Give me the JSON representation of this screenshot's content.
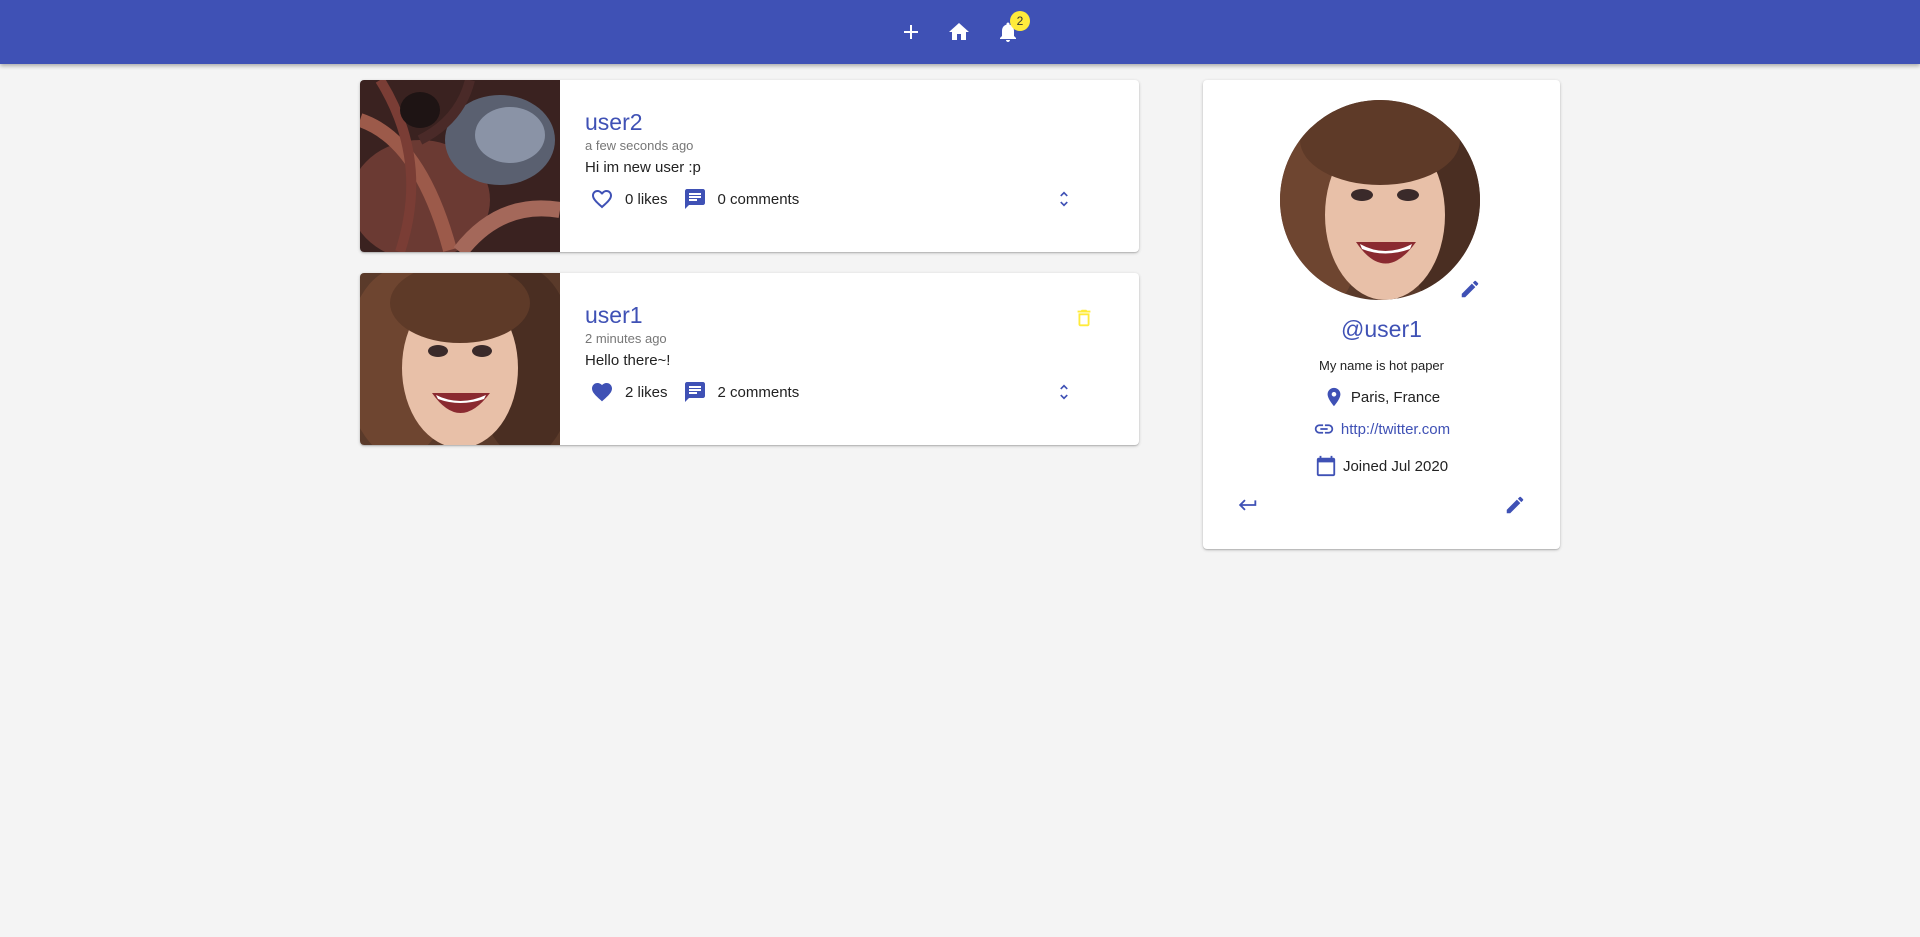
{
  "appbar": {
    "color": "#3f51b5",
    "buttons": [
      "add-icon",
      "home-icon",
      "notifications-icon"
    ],
    "notification_count": "2"
  },
  "screams": [
    {
      "user": "user2",
      "time": "a few seconds ago",
      "body": "Hi im new user :p",
      "likes": "0 likes",
      "comments": "0 comments",
      "liked": false,
      "deletable": false
    },
    {
      "user": "user1",
      "time": "2 minutes ago",
      "body": "Hello there~!",
      "likes": "2 likes",
      "comments": "2 comments",
      "liked": true,
      "deletable": true
    }
  ],
  "profile": {
    "handle": "@user1",
    "bio": "My name is hot paper",
    "location": "Paris, France",
    "website": "http://twitter.com",
    "joined": "Joined Jul 2020"
  },
  "colors": {
    "primary": "#3f51b5",
    "accent": "#ffeb3b",
    "background": "#f4f4f4"
  }
}
